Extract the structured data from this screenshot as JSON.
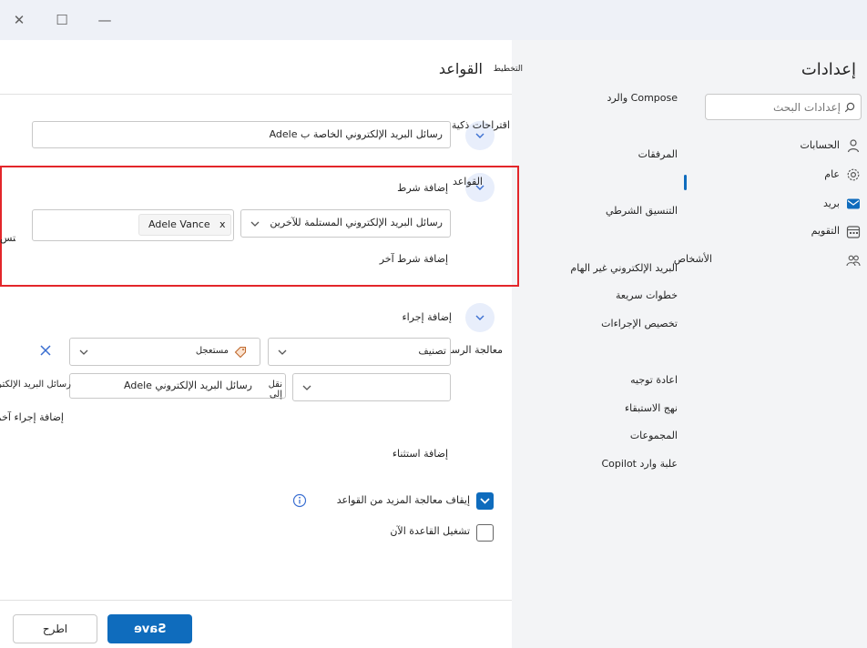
{
  "window": {
    "close_glyph": "✕",
    "maximize_glyph": "☐",
    "minimize_glyph": "—"
  },
  "settings_nav": {
    "title": "إعدادات",
    "search_placeholder": "إعدادات البحث",
    "categories": [
      {
        "label": "الحسابات",
        "icon": "person-icon"
      },
      {
        "label": "عام",
        "icon": "gear-icon"
      },
      {
        "label": "بريد",
        "icon": "mail-icon"
      },
      {
        "label": "التقويم",
        "icon": "calendar-icon"
      },
      {
        "label": "الأشخاص",
        "icon": "people-icon"
      }
    ]
  },
  "mail_subnav": {
    "items": [
      "Compose والرد",
      "المرفقات",
      "التنسيق الشرطي",
      "البريد الإلكتروني غير الهام",
      "خطوات سريعة",
      "تخصيص الإجراءات",
      "اعادة توجيه",
      "نهج الاستبقاء",
      "المجموعات",
      "علبة وارد Copilot"
    ]
  },
  "header": {
    "layout_label": "التخطيط",
    "rules_title": "القواعد"
  },
  "rule_name": {
    "label": "اقتراحات ذكية",
    "value": "رسائل البريد الإلكتروني الخاصة ب Adele"
  },
  "conditions": {
    "section_label": "القواعد",
    "add_condition_label": "إضافة شرط",
    "condition_select": "رسائل البريد الإلكتروني المستلمة للآخرين",
    "person_chip": "Adele Vance",
    "chip_remove": "x",
    "clipped_label": "كتس",
    "add_another_condition": "إضافة شرط آخر"
  },
  "actions": {
    "add_action_label": "إضافة إجراء",
    "categorize_label": "معالجة الرسائل",
    "categorize_select": "تصنيف",
    "category_value": "مستعجل",
    "move_select": "نقل إلى",
    "folder_value": "رسائل البريد الإلكتروني Adele",
    "clipped_folder_text": "رسائل البريد الإلكتروني الخاصة ب",
    "add_another_action": "إضافة إجراء آخر"
  },
  "exceptions": {
    "add_exception_label": "إضافة استثناء"
  },
  "options": {
    "stop_processing_label": "إيقاف معالجة المزيد من القواعد",
    "stop_processing_checked": true,
    "run_now_label": "تشغيل القاعدة الآن",
    "run_now_checked": false
  },
  "footer": {
    "save_label": "Save",
    "discard_label": "اطرح"
  },
  "colors": {
    "accent": "#0f6cbd",
    "highlight_border": "#e3262a",
    "nav_bg": "#f3f4f6",
    "titlebar_bg": "#eef1f7"
  }
}
